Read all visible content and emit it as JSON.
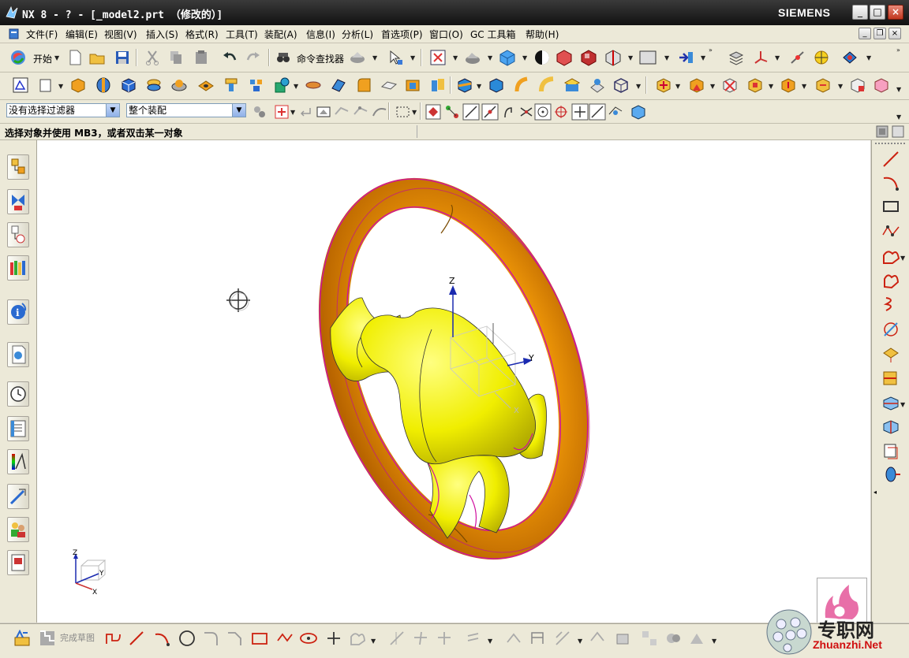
{
  "window": {
    "title": "NX 8 - ? - [_model2.prt （修改的）]",
    "brand": "SIEMENS",
    "controls": {
      "minimize": "_",
      "maximize": "□",
      "close": "×"
    }
  },
  "menu": {
    "items": [
      "文件(F)",
      "编辑(E)",
      "视图(V)",
      "插入(S)",
      "格式(R)",
      "工具(T)",
      "装配(A)",
      "信息(I)",
      "分析(L)",
      "首选项(P)",
      "窗口(O)",
      "GC 工具箱",
      "帮助(H)"
    ]
  },
  "toolbar1": {
    "start_label": "开始",
    "finder_label": "命令查找器"
  },
  "selection": {
    "filter_value": "没有选择过滤器",
    "scope_value": "整个装配"
  },
  "cue": "选择对象并使用 MB3，或者双击某一对象",
  "bottom": {
    "finish_sketch_label": "完成草图"
  },
  "watermark": {
    "site_cn": "专职网",
    "site_url": "Zhuanzhi.Net"
  },
  "model": {
    "axis_labels": {
      "z": "Z",
      "y": "Y",
      "x": "X"
    },
    "colors": {
      "rim": "#f2a20a",
      "hub": "#f2f20a",
      "edge": "#d010a0"
    }
  }
}
